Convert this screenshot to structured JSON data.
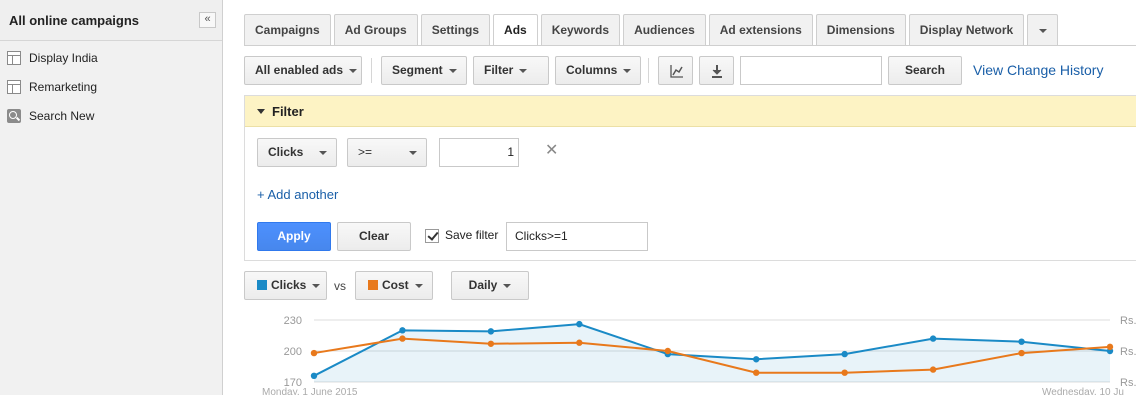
{
  "colors": {
    "clicks": "#1a8ac6",
    "cost": "#e8791c",
    "link": "#1a5fa8",
    "apply": "#4d90fe",
    "filter_bg": "#fdf3c4"
  },
  "sidebar": {
    "title": "All online campaigns",
    "collapse_icon": "«",
    "items": [
      {
        "label": "Display India",
        "icon": "campaign-icon"
      },
      {
        "label": "Remarketing",
        "icon": "campaign-icon"
      },
      {
        "label": "Search New",
        "icon": "search-campaign-icon"
      }
    ]
  },
  "tabs": [
    {
      "label": "Campaigns"
    },
    {
      "label": "Ad Groups"
    },
    {
      "label": "Settings"
    },
    {
      "label": "Ads",
      "active": true
    },
    {
      "label": "Keywords"
    },
    {
      "label": "Audiences"
    },
    {
      "label": "Ad extensions"
    },
    {
      "label": "Dimensions"
    },
    {
      "label": "Display Network"
    }
  ],
  "toolbar": {
    "status_filter": "All enabled ads",
    "segment": "Segment",
    "filter": "Filter",
    "columns": "Columns",
    "graph_icon": "line-chart-icon",
    "download_icon": "download-icon",
    "search_value": "",
    "search_button": "Search",
    "view_history": "View Change History"
  },
  "filter_panel": {
    "title": "Filter",
    "metric": "Clicks",
    "operator": ">=",
    "value": "1",
    "add_another": "+ Add another",
    "apply": "Apply",
    "clear": "Clear",
    "save_filter_label": "Save filter",
    "save_filter_checked": true,
    "save_filter_name": "Clicks>=1"
  },
  "chart_controls": {
    "metric1": "Clicks",
    "vs": "vs",
    "metric2": "Cost",
    "period": "Daily"
  },
  "chart_data": {
    "type": "line",
    "y_ticks": [
      "230",
      "200",
      "170"
    ],
    "ylim": [
      170,
      230
    ],
    "right_tick_label": "Rs.",
    "x_start_label": "Monday, 1 June 2015",
    "x_end_label": "Wednesday, 10 Ju",
    "grid": true,
    "series": [
      {
        "name": "Clicks",
        "values": [
          176,
          220,
          219,
          226,
          197,
          192,
          197,
          212,
          209,
          200
        ]
      },
      {
        "name": "Cost",
        "values": [
          198,
          212,
          207,
          208,
          200,
          179,
          179,
          182,
          198,
          204
        ]
      }
    ]
  }
}
